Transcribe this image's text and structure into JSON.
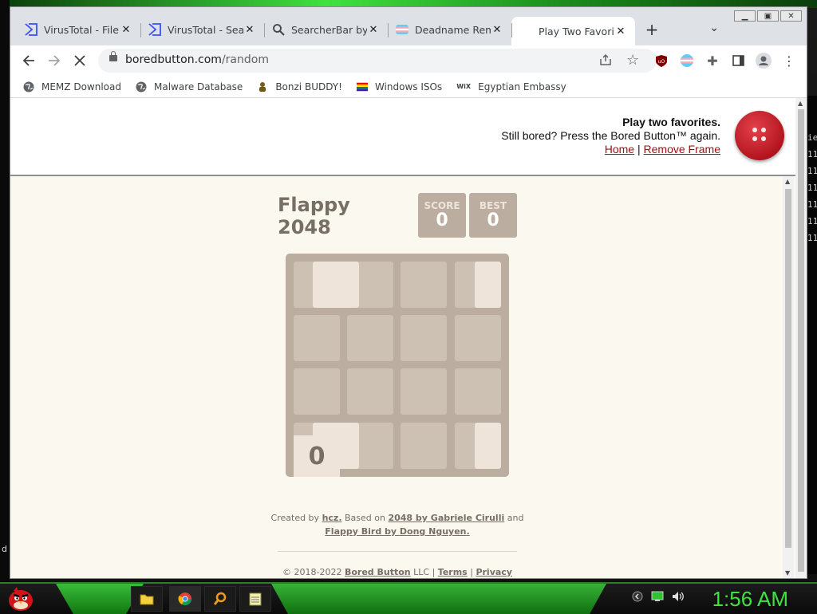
{
  "browser": {
    "tabs": [
      {
        "title": "VirusTotal - File -",
        "icon": "virustotal-icon"
      },
      {
        "title": "VirusTotal - Search",
        "icon": "virustotal-icon"
      },
      {
        "title": "SearcherBar by iE",
        "icon": "magnifier-icon"
      },
      {
        "title": "Deadname Remo",
        "icon": "trans-flag-icon"
      },
      {
        "title": "Play Two Favorite",
        "icon": "loading-icon"
      }
    ],
    "new_tab": "+",
    "url_host": "boredbutton.com",
    "url_path": "/random",
    "bookmarks": [
      {
        "label": "MEMZ Download",
        "icon": "globe-icon"
      },
      {
        "label": "Malware Database",
        "icon": "globe-icon"
      },
      {
        "label": "Bonzi BUDDY!",
        "icon": "bonzi-icon"
      },
      {
        "label": "Windows ISOs",
        "icon": "rainbow-flag-icon"
      },
      {
        "label": "Egyptian Embassy",
        "icon": "wix-icon"
      }
    ]
  },
  "bored_header": {
    "headline": "Play two favorites.",
    "subline": "Still bored? Press the Bored Button™ again.",
    "home_link": "Home",
    "separator": "|",
    "remove_link": "Remove Frame"
  },
  "game": {
    "title_line1": "Flappy",
    "title_line2": "2048",
    "score_label": "SCORE",
    "score": "0",
    "best_label": "BEST",
    "best": "0",
    "bird_value": "0",
    "credits": {
      "created_by": "Created by",
      "author": "hcz.",
      "based_on": "Based on",
      "source1": "2048 by Gabriele Cirulli",
      "and": "and",
      "source2": "Flappy Bird by Dong Nguyen."
    },
    "footer": {
      "copyright": "© 2018-2022",
      "company": "Bored Button",
      "llc": "LLC |",
      "terms": "Terms",
      "sep": "|",
      "privacy": "Privacy"
    }
  },
  "taskbar": {
    "clock": "1:56 AM"
  },
  "side_text": {
    "left": "d",
    "right": [
      "ie",
      "11",
      "11",
      "11",
      "11",
      "11",
      "11"
    ]
  }
}
